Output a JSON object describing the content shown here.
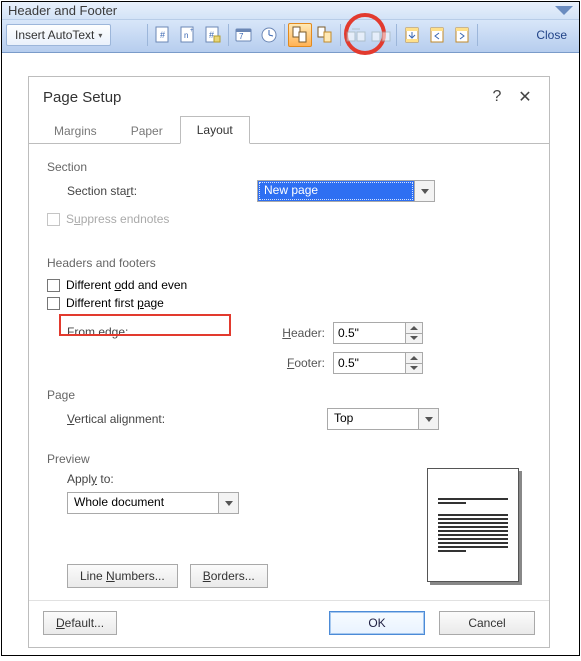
{
  "toolbar": {
    "title": "Header and Footer",
    "autotext_label": "Insert AutoText",
    "close_label": "Close"
  },
  "dialog": {
    "title": "Page Setup",
    "help_char": "?",
    "close_char": "✕",
    "tabs": {
      "margins": "Margins",
      "paper": "Paper",
      "layout": "Layout"
    },
    "section": {
      "heading": "Section",
      "start_label_pre": "Section sta",
      "start_label_u": "r",
      "start_label_post": "t:",
      "start_value": "New page",
      "suppress_pre": "S",
      "suppress_u": "u",
      "suppress_post": "ppress endnotes"
    },
    "hf": {
      "heading": "Headers and footers",
      "odd_even_pre": "Different ",
      "odd_even_u": "o",
      "odd_even_post": "dd and even",
      "first_page_pre": "Different first ",
      "first_page_u": "p",
      "first_page_post": "age",
      "from_edge_label": "From edge:",
      "header_u": "H",
      "header_post": "eader:",
      "header_value": "0.5\"",
      "footer_u": "F",
      "footer_post": "ooter:",
      "footer_value": "0.5\""
    },
    "page": {
      "heading": "Page",
      "valign_u": "V",
      "valign_post": "ertical alignment:",
      "valign_value": "Top"
    },
    "preview": {
      "heading": "Preview",
      "apply_pre": "Appl",
      "apply_u": "y",
      "apply_post": " to:",
      "apply_value": "Whole document"
    },
    "buttons": {
      "line_numbers_pre": "Line ",
      "line_numbers_u": "N",
      "line_numbers_post": "umbers...",
      "borders_u": "B",
      "borders_post": "orders...",
      "default_u": "D",
      "default_post": "efault...",
      "ok": "OK",
      "cancel": "Cancel"
    }
  }
}
